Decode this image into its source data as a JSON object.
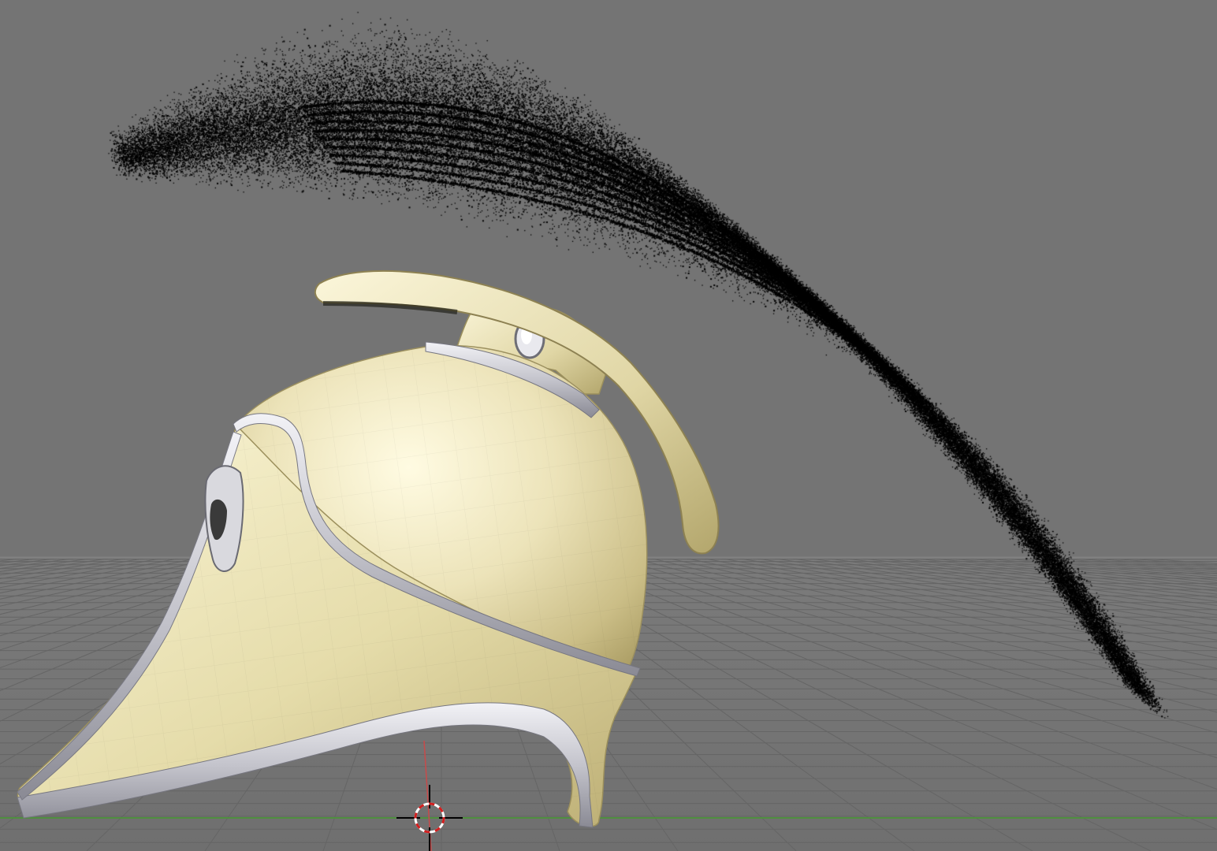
{
  "viewport": {
    "background": "#747474",
    "grid_color": "#6a6a6a",
    "horizon_color": "#7a7a7a",
    "x_axis_color": "#4f8f3f",
    "z_axis_color": "#c84a4a"
  },
  "scene": {
    "objects": [
      "helmet",
      "crest",
      "plume-particles"
    ],
    "helmet_color": "#e8e0b0",
    "trim_color": "#c9c9cf",
    "particle_color": "#000000"
  },
  "cursor_3d": {
    "icon": "3d-cursor-icon",
    "colors": [
      "#d21e1e",
      "#ffffff"
    ]
  }
}
